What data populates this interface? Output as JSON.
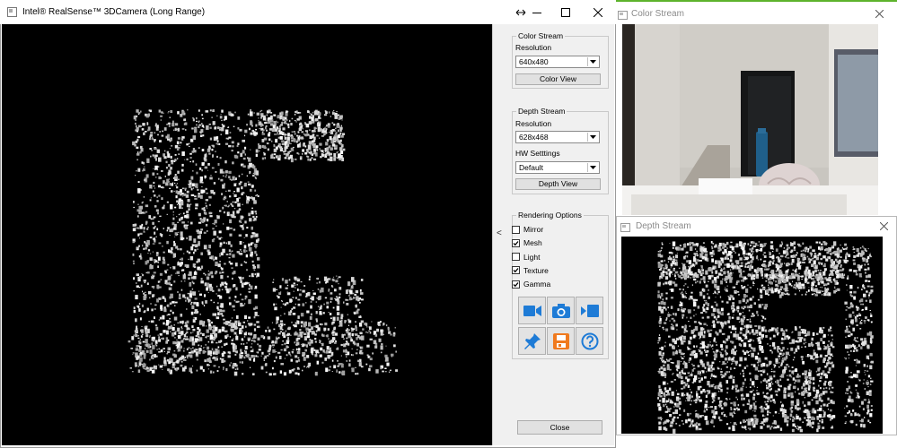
{
  "main_window": {
    "title": "Intel® RealSense™ 3DCamera (Long Range)",
    "controls": [
      "swap-arrows-icon",
      "minimize-icon",
      "maximize-icon",
      "close-icon"
    ],
    "collapse_glyph": "<"
  },
  "side_panel": {
    "color_stream": {
      "legend": "Color Stream",
      "resolution_label": "Resolution",
      "resolution_value": "640x480",
      "view_button": "Color View"
    },
    "depth_stream": {
      "legend": "Depth Stream",
      "resolution_label": "Resolution",
      "resolution_value": "628x468",
      "hw_settings_label": "HW Setttings",
      "hw_settings_value": "Default",
      "view_button": "Depth View"
    },
    "rendering_options": {
      "legend": "Rendering Options",
      "options": [
        {
          "label": "Mirror",
          "checked": false
        },
        {
          "label": "Mesh",
          "checked": true
        },
        {
          "label": "Light",
          "checked": false
        },
        {
          "label": "Texture",
          "checked": true
        },
        {
          "label": "Gamma",
          "checked": true
        }
      ]
    },
    "tool_buttons": [
      "video-camera-icon",
      "camera-icon",
      "record-toggle-icon",
      "pin-icon",
      "save-icon",
      "help-icon"
    ],
    "close_button": "Close"
  },
  "color_window": {
    "title": "Color Stream"
  },
  "depth_window": {
    "title": "Depth Stream"
  },
  "colors": {
    "accent_green": "#5db32c",
    "tool_blue": "#1e7bd6",
    "tool_orange": "#f07a1e",
    "panel_bg": "#f0f0f0"
  }
}
